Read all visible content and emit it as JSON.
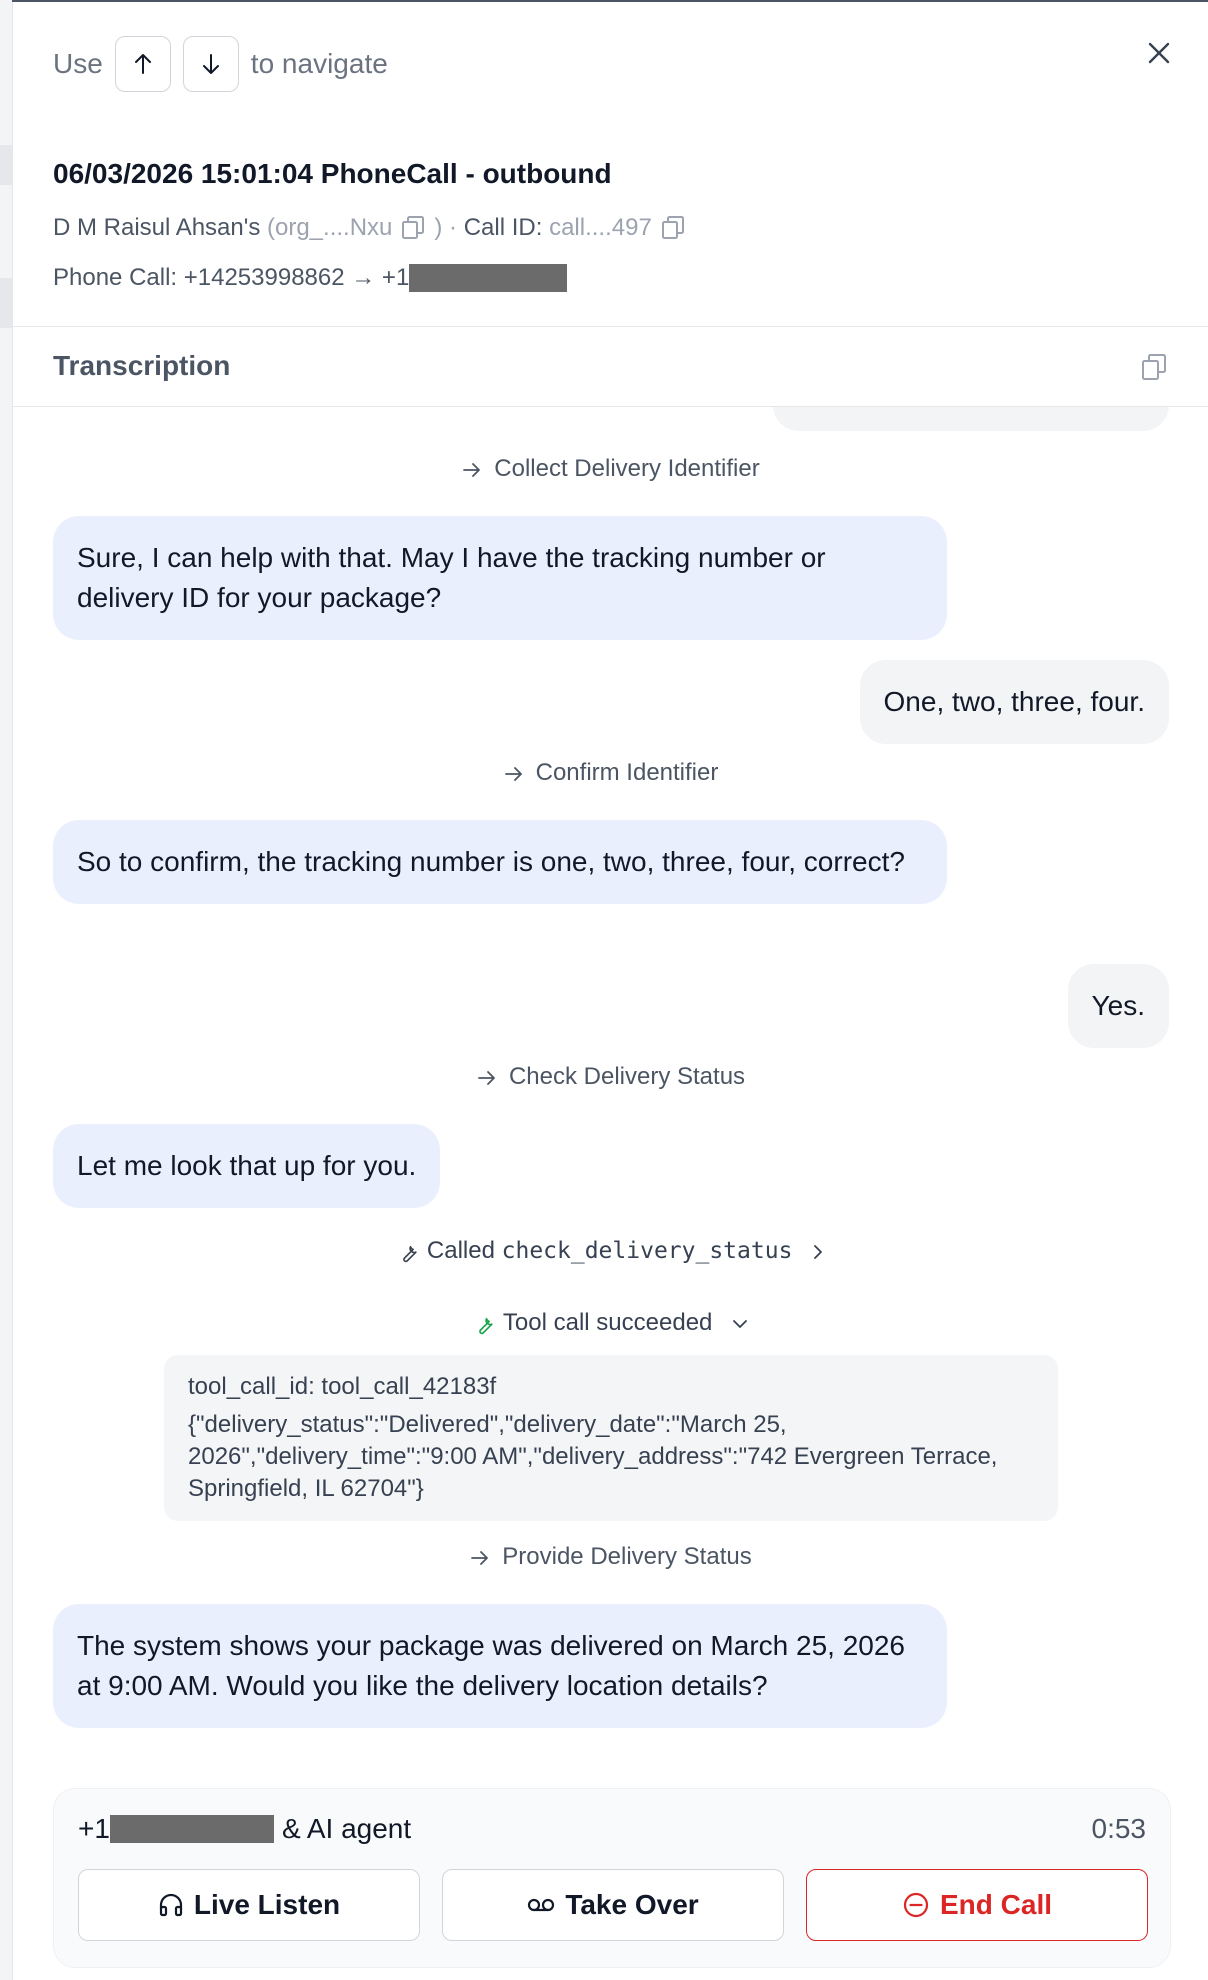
{
  "nav": {
    "use_label": "Use",
    "navigate_label": "to navigate"
  },
  "call": {
    "title": "06/03/2026 15:01:04 PhoneCall - outbound",
    "org_name": "D M Raisul Ahsan's",
    "org_id_prefix": "(org_....Nxu",
    "org_suffix": ") ·",
    "call_id_label": "Call ID:",
    "call_id": "call....497",
    "phone_prefix": "Phone Call: +14253998862 → +1"
  },
  "transcription": {
    "heading": "Transcription",
    "items": [
      {
        "kind": "step",
        "text": "Collect Delivery Identifier"
      },
      {
        "kind": "agent",
        "text": "Sure, I can help with that. May I have the tracking number or delivery ID for your package?"
      },
      {
        "kind": "user",
        "text": "One, two, three, four."
      },
      {
        "kind": "step",
        "text": "Confirm Identifier"
      },
      {
        "kind": "agent",
        "text": "So to confirm, the tracking number is one, two, three, four, correct?"
      },
      {
        "kind": "user",
        "text": "Yes."
      },
      {
        "kind": "step",
        "text": "Check Delivery Status"
      },
      {
        "kind": "agent",
        "text": "Let me look that up for you."
      },
      {
        "kind": "tool_called",
        "prefix": "Called",
        "name": "check_delivery_status"
      },
      {
        "kind": "tool_result",
        "status": "Tool call succeeded",
        "id_line": "tool_call_id: tool_call_42183f",
        "payload": "{\"delivery_status\":\"Delivered\",\"delivery_date\":\"March 25, 2026\",\"delivery_time\":\"9:00 AM\",\"delivery_address\":\"742 Evergreen Terrace, Springfield, IL 62704\"}"
      },
      {
        "kind": "step",
        "text": "Provide Delivery Status"
      },
      {
        "kind": "agent",
        "text": "The system shows your package was delivered on March 25, 2026 at 9:00 AM. Would you like the delivery location details?"
      }
    ]
  },
  "footer": {
    "participant_prefix": "+1",
    "participant_suffix": "& AI agent",
    "timer": "0:53",
    "live_listen": "Live Listen",
    "take_over": "Take Over",
    "end_call": "End Call"
  },
  "icons": {
    "close": "close-icon",
    "copy": "copy-icon",
    "arrow_up": "arrow-up-icon",
    "arrow_down": "arrow-down-icon",
    "step_arrow": "arrow-right-icon",
    "wrench": "wrench-icon",
    "headphones": "headphones-icon",
    "voicemail": "voicemail-icon",
    "minus_circle": "minus-circle-icon"
  },
  "colors": {
    "agent_bubble": "#e9effd",
    "user_bubble": "#f3f4f6",
    "danger": "#dc2626",
    "success": "#16a34a"
  }
}
